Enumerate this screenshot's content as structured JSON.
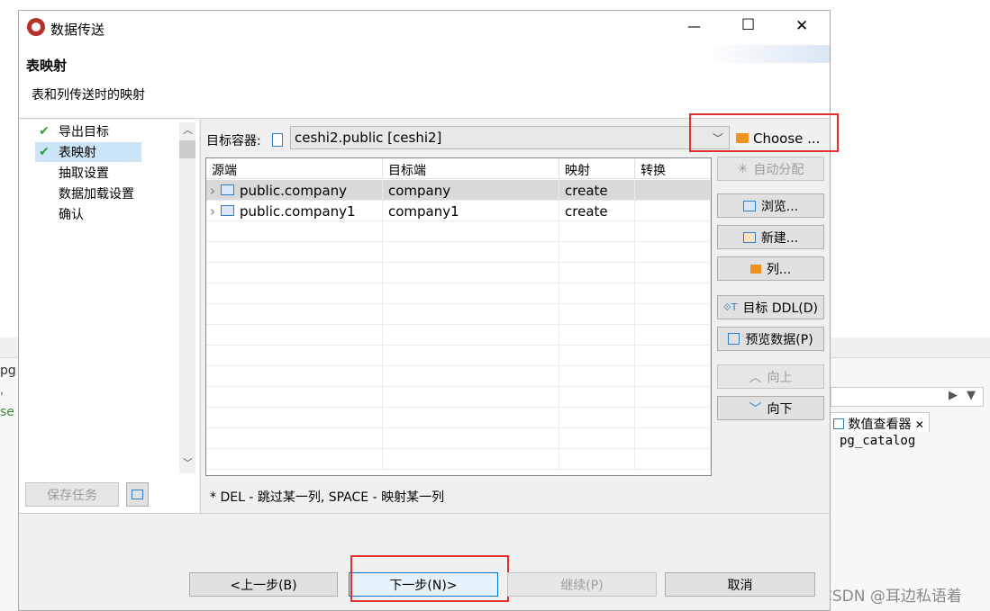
{
  "window": {
    "title": "数据传送",
    "minimize": "—",
    "maximize": "☐",
    "close": "✕"
  },
  "header": {
    "title": "表映射",
    "subtitle": "表和列传送时的映射"
  },
  "nav": {
    "items": [
      {
        "label": "导出目标",
        "checked": true,
        "selected": false
      },
      {
        "label": "表映射",
        "checked": true,
        "selected": true
      },
      {
        "label": "抽取设置",
        "checked": false,
        "selected": false
      },
      {
        "label": "数据加载设置",
        "checked": false,
        "selected": false
      },
      {
        "label": "确认",
        "checked": false,
        "selected": false
      }
    ]
  },
  "left_buttons": {
    "save_task": "保存任务"
  },
  "target": {
    "label": "目标容器:",
    "value": "ceshi2.public  [ceshi2]",
    "choose": "Choose ..."
  },
  "table": {
    "columns": [
      "源端",
      "目标端",
      "映射",
      "转换"
    ],
    "rows": [
      {
        "source": "public.company",
        "target": "company",
        "mapping": "create",
        "transform": ""
      },
      {
        "source": "public.company1",
        "target": "company1",
        "mapping": "create",
        "transform": ""
      }
    ]
  },
  "side_buttons": {
    "auto_assign": "自动分配",
    "browse": "浏览...",
    "new": "新建...",
    "columns": "列...",
    "target_ddl": "目标 DDL(D)",
    "preview": "预览数据(P)",
    "up": "向上",
    "down": "向下"
  },
  "hint": "* DEL - 跳过某一列, SPACE - 映射某一列",
  "footer": {
    "back": "<上一步(B)",
    "next": "下一步(N)>",
    "continue": "继续(P)",
    "cancel": "取消"
  },
  "background": {
    "tab_label": "数值查看器",
    "catalog": "pg_catalog",
    "left_pg": "pg",
    "left_se": "' se",
    "watermark": "CSDN @耳边私语着"
  },
  "colors": {
    "check": "#2e9d3a",
    "selected_bg": "#cce4f7",
    "red_highlight": "#e03030",
    "folder": "#f0901e",
    "table_icon": "#2f7fc8"
  }
}
